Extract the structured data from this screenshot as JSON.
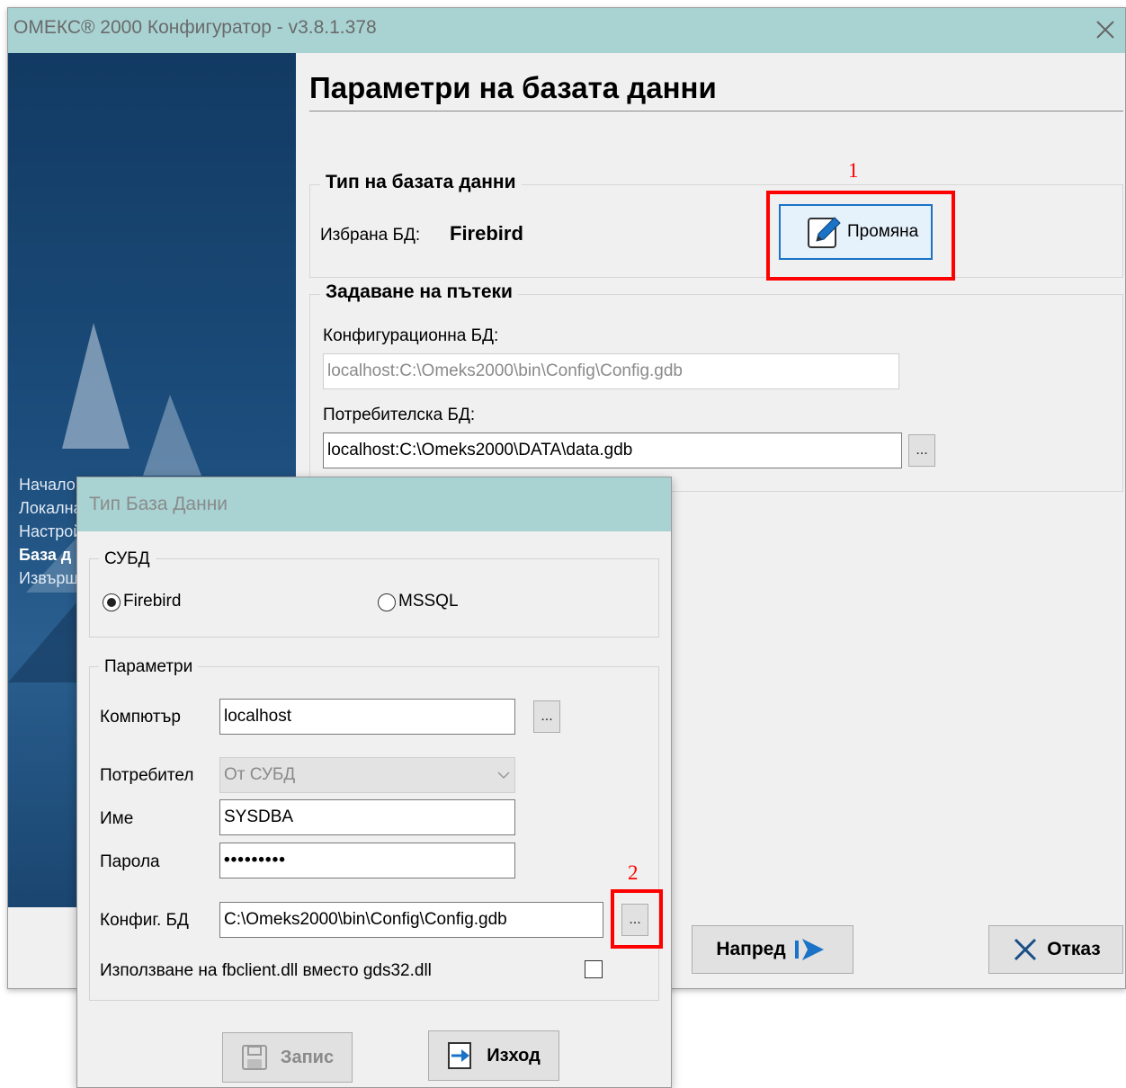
{
  "window": {
    "title": "ОМЕКС® 2000 Конфигуратор - v3.8.1.378",
    "close_icon": "close-icon"
  },
  "sidebar": {
    "items": [
      {
        "label": "Начало",
        "active": false
      },
      {
        "label": "Локална",
        "active": false
      },
      {
        "label": "Настрой",
        "active": false
      },
      {
        "label": "База д",
        "active": true
      },
      {
        "label": "Извърш",
        "active": false
      }
    ]
  },
  "page": {
    "title": "Параметри на базата данни",
    "db_type_group": {
      "label": "Тип на базата данни",
      "selected_label": "Избрана БД:",
      "selected_value": "Firebird",
      "change_button": "Промяна",
      "marker": "1"
    },
    "paths_group": {
      "label": "Задаване на пътеки",
      "config_db_label": "Конфигурационна БД:",
      "config_db_value": "localhost:C:\\Omeks2000\\bin\\Config\\Config.gdb",
      "user_db_label": "Потребителска БД:",
      "user_db_value": "localhost:C:\\Omeks2000\\DATA\\data.gdb",
      "browse_button": "..."
    },
    "next_button": "Напред",
    "cancel_button": "Отказ"
  },
  "dialog": {
    "title": "Тип База Данни",
    "dbms_group": {
      "label": "СУБД",
      "options": [
        {
          "label": "Firebird",
          "checked": true
        },
        {
          "label": "MSSQL",
          "checked": false
        }
      ]
    },
    "params_group": {
      "label": "Параметри",
      "computer_label": "Компютър",
      "computer_value": "localhost",
      "user_label": "Потребител",
      "user_value": "От СУБД",
      "name_label": "Име",
      "name_value": "SYSDBA",
      "password_label": "Парола",
      "password_value": "•••••••••",
      "config_label": "Конфиг. БД",
      "config_value": "C:\\Omeks2000\\bin\\Config\\Config.gdb",
      "browse_button": "...",
      "marker": "2",
      "fbclient_label": "Използване на fbclient.dll вместо gds32.dll",
      "fbclient_checked": false
    },
    "save_button": "Запис",
    "exit_button": "Изход"
  },
  "colors": {
    "title_bar": "#a9d3d3",
    "highlight": "#ff0000",
    "accent_blue": "#1a73c6"
  }
}
